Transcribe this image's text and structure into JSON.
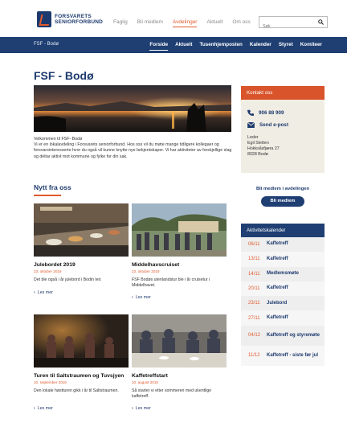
{
  "header": {
    "logo_line1": "FORSVARETS",
    "logo_line2": "SENIORFORBUND",
    "nav": [
      "Faglig",
      "Bli medlem",
      "Avdelinger",
      "Aktuelt",
      "Om oss"
    ],
    "active_nav": "Avdelinger",
    "search_placeholder": "Søk"
  },
  "mainnav": {
    "crumb": "FSF - Bodø",
    "links": [
      "Forside",
      "Aktuelt",
      "Tusenhjemposten",
      "Kalender",
      "Styret",
      "Komiteer"
    ],
    "active": "Forside"
  },
  "page": {
    "title": "FSF - Bodø",
    "intro": "Velkommen til FSF- Bodø\nVi er en lokalavdeling i Forsvarets seniorforbund. Hos oss vil du møte mange tidligere kollegaer og forsvarsinteresserte hvor du også vil kunne knytte nye bekjentskaper. Vi har aktiviteter av forskjellige slag og deltar aktivt mot kommune og fylke for din sak.",
    "news_title": "Nytt fra oss"
  },
  "news": [
    {
      "title": "Julebordet 2019",
      "date": "23. oktober 2019",
      "desc": "Det ble også i år julebord i Bodin leir.",
      "more": "Les mer"
    },
    {
      "title": "Middelhavscruiset",
      "date": "23. oktober 2019",
      "desc": "FSF Bodøs utenlandstur ble i år cruisetur i Middelhavet.",
      "more": "Les mer"
    },
    {
      "title": "Turen til Saltstraumen og Tuvsjyen",
      "date": "10. september 2019",
      "desc": "Den lokale høstturen gikk i år til Saltstraumen.",
      "more": "Les mer"
    },
    {
      "title": "Kaffetreffstart",
      "date": "10. august 2019",
      "desc": "Så starter vi etter sommeren med ukentlige kaffetreff.",
      "more": "Les mer"
    }
  ],
  "contact": {
    "title": "Kontakt oss",
    "phone": "906 88 909",
    "email_label": "Send e-post",
    "address": [
      "Leder",
      "Egil Sletten",
      "Hokksåsfjæra 27",
      "8028 Bodø"
    ]
  },
  "join": {
    "text": "Bli medlem i avdelingen",
    "button": "Bli medlem"
  },
  "calendar": {
    "title": "Aktivitetskalender",
    "events": [
      {
        "date": "06/11",
        "title": "Kaffetreff"
      },
      {
        "date": "13/11",
        "title": "Kaffetreff"
      },
      {
        "date": "14/11",
        "title": "Medlemsmøte"
      },
      {
        "date": "20/11",
        "title": "Kaffetreff"
      },
      {
        "date": "23/11",
        "title": "Julebord"
      },
      {
        "date": "27/11",
        "title": "Kaffetreff"
      },
      {
        "date": "04/12",
        "title": "Kaffetreff og styremøte"
      },
      {
        "date": "11/12",
        "title": "Kaffetreff - siste før jul"
      }
    ]
  },
  "colors": {
    "brand_blue": "#1f3f73",
    "accent_orange": "#e15a2d",
    "sidebar_bg": "#f0ede4"
  }
}
